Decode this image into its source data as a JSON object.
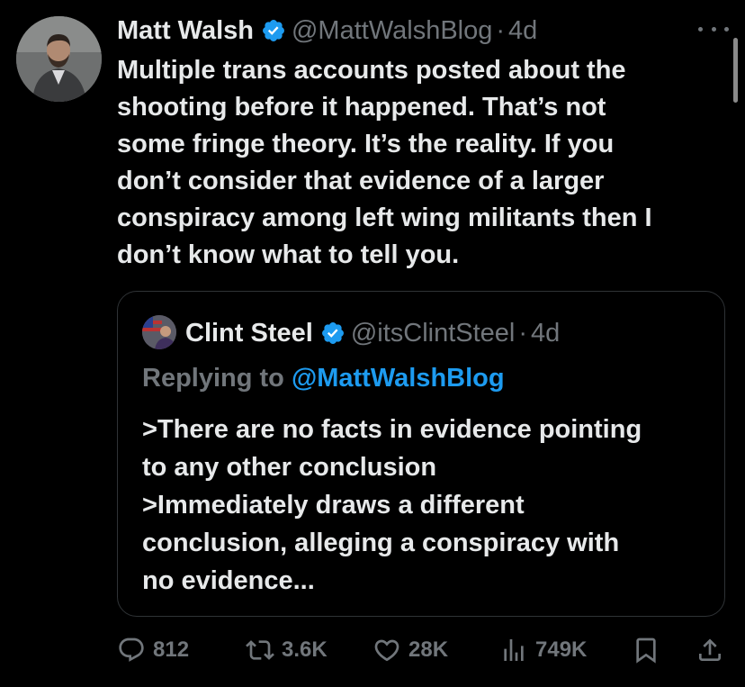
{
  "tweet": {
    "author_name": "Matt Walsh",
    "handle": "@MattWalshBlog",
    "separator": "·",
    "time": "4d",
    "text": "Multiple trans accounts posted about the\nshooting before it happened. That’s not\nsome fringe theory. It’s the reality. If you\ndon’t consider that evidence of a larger\nconspiracy among left wing militants then I\ndon’t know what to tell you."
  },
  "quote": {
    "author_name": "Clint Steel",
    "handle": "@itsClintSteel",
    "separator": "·",
    "time": "4d",
    "replying_prefix": "Replying to ",
    "replying_to": "@MattWalshBlog",
    "text": ">There are no facts in evidence pointing\nto any other conclusion\n>Immediately draws a different\nconclusion, alleging a conspiracy with\nno evidence..."
  },
  "actions": {
    "replies": "812",
    "reposts": "3.6K",
    "likes": "28K",
    "views": "749K"
  },
  "icons": {
    "verified": "verified-badge-icon",
    "more": "more-icon",
    "reply": "reply-icon",
    "repost": "repost-icon",
    "like": "like-icon",
    "views": "views-icon",
    "bookmark": "bookmark-icon",
    "share": "share-icon"
  },
  "colors": {
    "background": "#000000",
    "text": "#e7e9ea",
    "muted": "#71767b",
    "accent": "#1d9bf0",
    "border": "#2f3336"
  }
}
